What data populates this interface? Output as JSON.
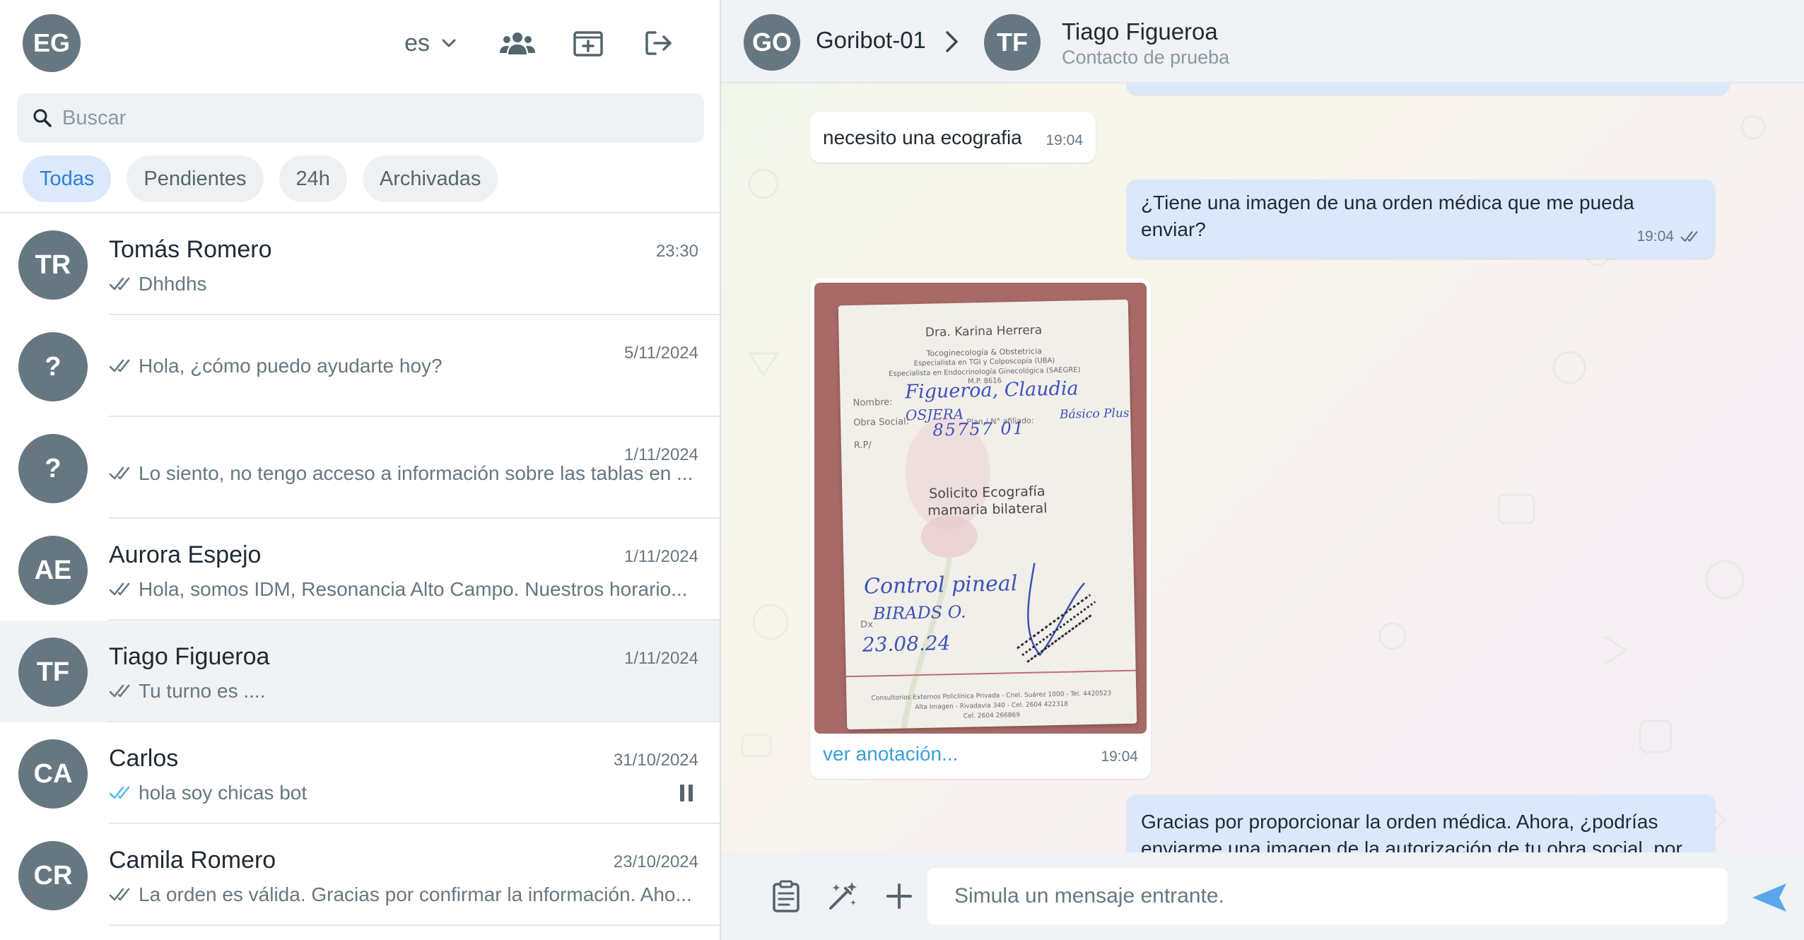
{
  "me": {
    "initials": "EG"
  },
  "header_left": {
    "language": "es",
    "icons": [
      "language-chevron-down-icon",
      "users-group-icon",
      "new-chat-icon",
      "logout-icon"
    ]
  },
  "search": {
    "placeholder": "Buscar",
    "value": ""
  },
  "filters": [
    {
      "label": "Todas",
      "active": true
    },
    {
      "label": "Pendientes",
      "active": false
    },
    {
      "label": "24h",
      "active": false
    },
    {
      "label": "Archivadas",
      "active": false
    }
  ],
  "chats": [
    {
      "initials": "TR",
      "name": "Tomás Romero",
      "date": "23:30",
      "preview": "Dhhdhs",
      "tick_color": "#667781"
    },
    {
      "initials": "?",
      "name": "",
      "date": "5/11/2024",
      "preview": "Hola, ¿cómo puedo ayudarte hoy?",
      "tick_color": "#667781"
    },
    {
      "initials": "?",
      "name": "",
      "date": "1/11/2024",
      "preview": "Lo siento, no tengo acceso a información sobre las tablas en ...",
      "tick_color": "#667781"
    },
    {
      "initials": "AE",
      "name": "Aurora Espejo",
      "date": "1/11/2024",
      "preview": "Hola, somos IDM, Resonancia Alto Campo. Nuestros horario...",
      "tick_color": "#667781"
    },
    {
      "initials": "TF",
      "name": "Tiago Figueroa",
      "date": "1/11/2024",
      "preview": "Tu turno es ....",
      "tick_color": "#667781",
      "selected": true
    },
    {
      "initials": "CA",
      "name": "Carlos",
      "date": "31/10/2024",
      "preview": "hola soy chicas bot",
      "tick_color": "#53bdeb",
      "paused": true
    },
    {
      "initials": "CR",
      "name": "Camila Romero",
      "date": "23/10/2024",
      "preview": "La orden es válida. Gracias por confirmar la información. Aho...",
      "tick_color": "#667781"
    }
  ],
  "chat_header": {
    "bot_initials": "GO",
    "bot_name": "Goribot-01",
    "contact_initials": "TF",
    "contact_name": "Tiago Figueroa",
    "contact_subtitle": "Contacto de prueba"
  },
  "messages": [
    {
      "direction": "in",
      "text": "necesito una ecografia",
      "time": "19:04"
    },
    {
      "direction": "out",
      "text": "¿Tiene una imagen de una orden médica que me pueda enviar?",
      "time": "19:04"
    },
    {
      "direction": "in",
      "type": "image",
      "link": "ver anotación...",
      "time": "19:04"
    },
    {
      "direction": "out",
      "text": "Gracias por proporcionar la orden médica. Ahora, ¿podrías enviarme una imagen de la autorización de tu obra social, por",
      "time": ""
    }
  ],
  "photo": {
    "doctor": "Dra. Karina Herrera",
    "specialty_1": "Tocoginecología & Obstetricia",
    "specialty_2": "Especialista en TGI y Colposcopía (UBA)",
    "specialty_3": "Especialista en Endocrinología Ginecológica (SAEGRE)",
    "mp": "M.P. 8616",
    "label_nombre": "Nombre:",
    "label_obra": "Obra Social:",
    "label_plan": "Plan / N° afiliado:",
    "label_rp": "R.P/",
    "label_dx": "Dx",
    "hw_name": "Figueroa, Claudia",
    "hw_obra": "OSJERA",
    "hw_plan": "Básico Plus",
    "hw_num": "85757 01",
    "request_1": "Solicito Ecografía",
    "request_2": "mamaria bilateral",
    "hw_control": "Control pineal",
    "hw_birads": "BIRADS O.",
    "hw_date": "23.08.24",
    "footer_1": "Consultorios Externos Policlínica Privada - Cnel. Suárez 1000 - Tel. 4420523",
    "footer_2": "Alta Imagen - Rivadavia 340 - Cel. 2604 422318",
    "footer_3": "Cel. 2604 266869"
  },
  "composer": {
    "placeholder": "Simula un mensaje entrante.",
    "value": ""
  },
  "colors": {
    "accent": "#2f7fd8",
    "avatar": "#667781",
    "outgoing_bubble": "#dbe8fb",
    "read_tick": "#53bdeb"
  }
}
